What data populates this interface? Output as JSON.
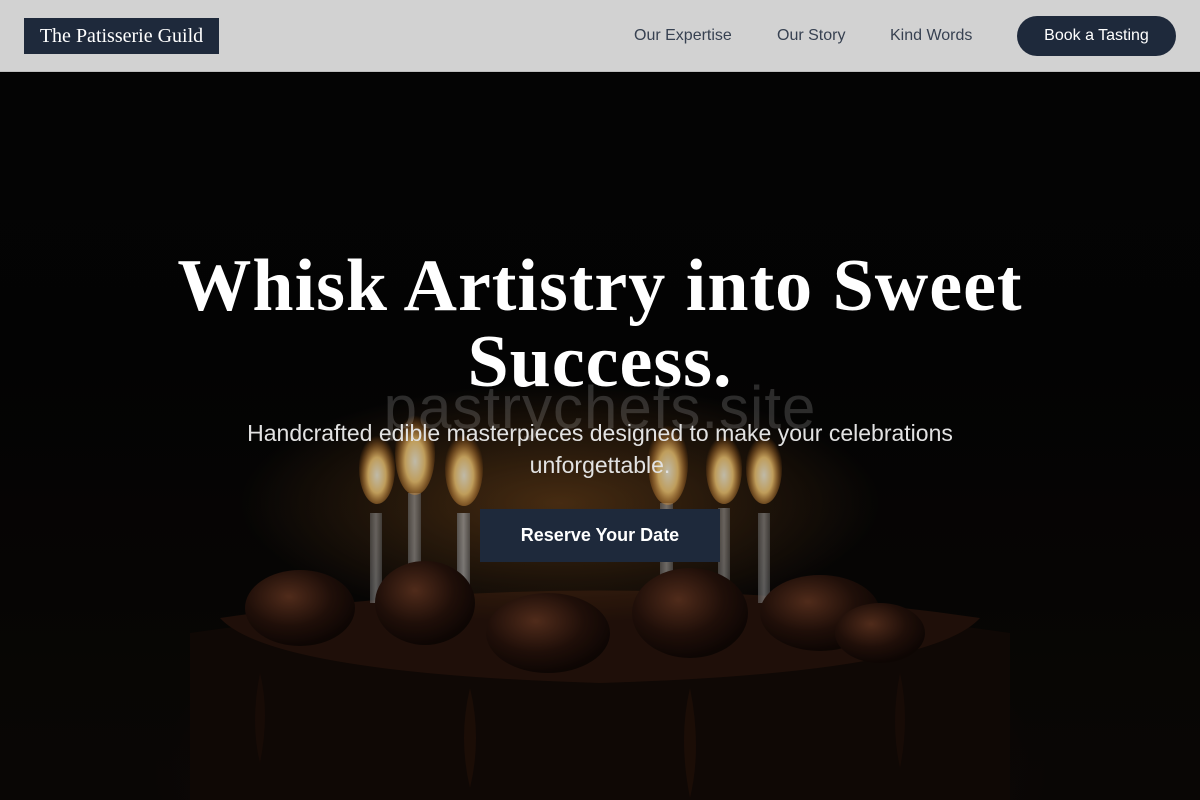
{
  "header": {
    "logo_text": "The Patisserie Guild",
    "nav": [
      {
        "label": "Our Expertise"
      },
      {
        "label": "Our Story"
      },
      {
        "label": "Kind Words"
      }
    ],
    "cta_label": "Book a Tasting"
  },
  "hero": {
    "watermark": "pastrychefs.site",
    "headline_line1": "Whisk Artistry into Sweet",
    "headline_line2": "Success.",
    "subheadline_line1": "Handcrafted edible masterpieces designed to make your celebrations",
    "subheadline_line2": "unforgettable.",
    "cta_label": "Reserve Your Date",
    "background_image": "chocolate-cake-with-lit-candles"
  },
  "colors": {
    "header_bg": "#d2d2d2",
    "brand_navy": "#1e293b",
    "nav_text": "#374151",
    "hero_text": "#ffffff"
  }
}
